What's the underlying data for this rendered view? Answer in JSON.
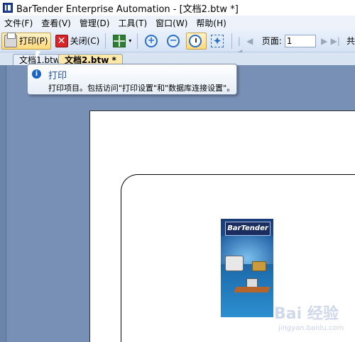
{
  "window": {
    "title": "BarTender Enterprise Automation - [文档2.btw *]"
  },
  "menu": [
    "文件(F)",
    "查看(V)",
    "管理(D)",
    "工具(T)",
    "窗口(W)",
    "帮助(H)"
  ],
  "toolbar": {
    "print_label": "打印(P)",
    "close_label": "关闭(C)",
    "close_glyph": "✕",
    "zoom_in_glyph": "+",
    "zoom_out_glyph": "−",
    "dropdown_glyph": "▾",
    "page_label": "页面:",
    "page_value": "1",
    "total_label": "共",
    "nav": [
      "|◀",
      "◀",
      "▶",
      "▶|"
    ]
  },
  "tabs": [
    "文档1.btw *",
    "文档2.btw *"
  ],
  "tooltip": {
    "icon": "i",
    "title": "打印",
    "body": "打印项目。包括访问\"打印设置\"和\"数据库连接设置\"。"
  },
  "picture": {
    "logo_text": "BarTender"
  },
  "watermark": {
    "text": "Bai 经验",
    "sub": "jingyan.baidu.com"
  },
  "colors": {
    "accent": "#1a62c4",
    "workspace": "#6a84aa",
    "toolbar": "#d6e3f4",
    "active_button": "#ffd97a"
  }
}
